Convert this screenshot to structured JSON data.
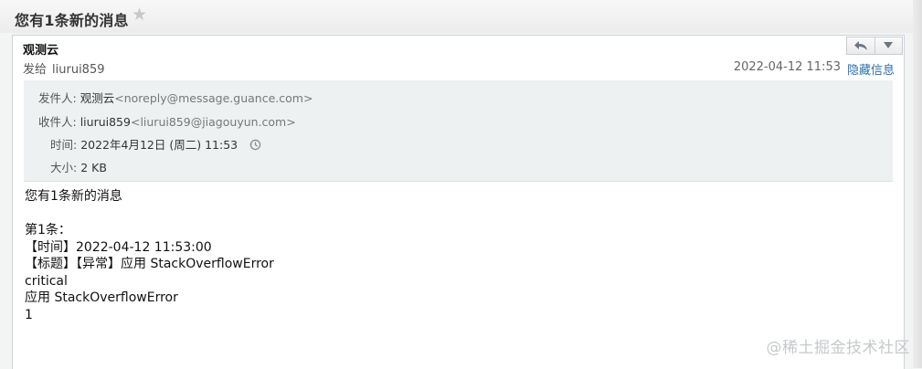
{
  "header": {
    "subject": "您有1条新的消息",
    "star_icon": "star-icon"
  },
  "mail": {
    "sender_name": "观测云",
    "to_label": "发给",
    "to_user": "liurui859",
    "datetime": "2022-04-12 11:53",
    "hide_info": "隐藏信息",
    "actions": {
      "reply_icon": "reply-icon",
      "more_icon": "dropdown-arrow-icon"
    }
  },
  "meta": {
    "from_label": "发件人:",
    "from_name": "观测云",
    "from_addr": "<noreply@message.guance.com>",
    "to_label": "收件人:",
    "to_name": "liurui859",
    "to_addr": "<liurui859@jiagouyun.com>",
    "time_label": "时间:",
    "time_value": "2022年4月12日 (周二) 11:53",
    "size_label": "大小:",
    "size_value": "2 KB"
  },
  "body": {
    "lines": [
      "您有1条新的消息",
      "",
      "第1条：",
      "【时间】2022-04-12 11:53:00",
      "【标题】【异常】应用 StackOverflowError",
      "critical",
      "应用 StackOverflowError",
      "1"
    ]
  },
  "watermark": "@稀土掘金技术社区"
}
